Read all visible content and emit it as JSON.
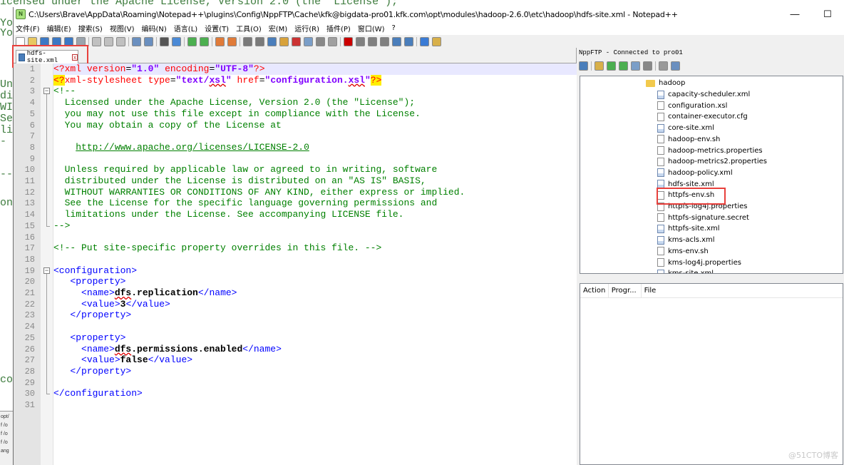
{
  "background": {
    "top_text": "icensed under the Apache License, Version 2.0 (the \"License\");",
    "left_fragments": [
      "Yo",
      "Yo",
      "Uni",
      "dis",
      "WIT",
      "See",
      "lin",
      "-",
      "--",
      "on",
      "co"
    ],
    "bottom_fragments": [
      "opt/",
      "f /o",
      "f /o",
      "f /o",
      "ang"
    ]
  },
  "window": {
    "title": "C:\\Users\\Brave\\AppData\\Roaming\\Notepad++\\plugins\\Config\\NppFTP\\Cache\\kfk@bigdata-pro01.kfk.com\\opt\\modules\\hadoop-2.6.0\\etc\\hadoop\\hdfs-site.xml - Notepad++",
    "minimize": "—",
    "maximize": "☐"
  },
  "menu": [
    "文件(F)",
    "编辑(E)",
    "搜索(S)",
    "视图(V)",
    "编码(N)",
    "语言(L)",
    "设置(T)",
    "工具(O)",
    "宏(M)",
    "运行(R)",
    "插件(P)",
    "窗口(W)",
    "?"
  ],
  "tab": {
    "label": "hdfs-site.xml",
    "close": "x"
  },
  "editor": {
    "line_numbers": [
      "1",
      "2",
      "3",
      "4",
      "5",
      "6",
      "7",
      "8",
      "9",
      "10",
      "11",
      "12",
      "13",
      "14",
      "15",
      "16",
      "17",
      "18",
      "19",
      "20",
      "21",
      "22",
      "23",
      "24",
      "25",
      "26",
      "27",
      "28",
      "29",
      "30",
      "31"
    ]
  },
  "ftp": {
    "title": "NppFTP - Connected to pro01",
    "folder": "hadoop",
    "files": [
      "capacity-scheduler.xml",
      "configuration.xsl",
      "container-executor.cfg",
      "core-site.xml",
      "hadoop-env.sh",
      "hadoop-metrics.properties",
      "hadoop-metrics2.properties",
      "hadoop-policy.xml",
      "hdfs-site.xml",
      "httpfs-env.sh",
      "httpfs-log4j.properties",
      "httpfs-signature.secret",
      "httpfs-site.xml",
      "kms-acls.xml",
      "kms-env.sh",
      "kms-log4j.properties",
      "kms-site.xml"
    ],
    "queue_columns": [
      "Action",
      "Progr...",
      "File"
    ]
  },
  "watermark": "@51CTO博客"
}
